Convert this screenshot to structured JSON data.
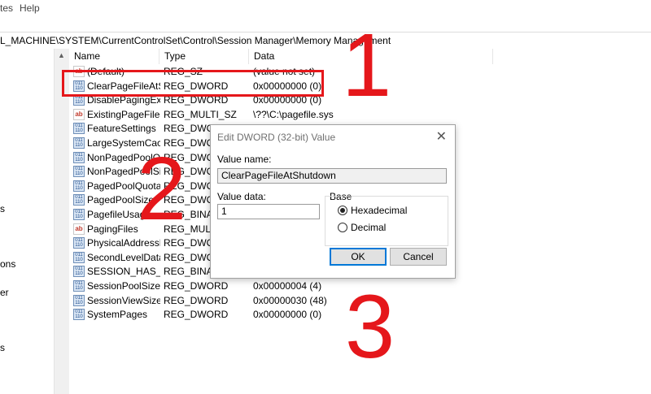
{
  "menubar": {
    "items": [
      "tes",
      "Help"
    ]
  },
  "address": {
    "path": "L_MACHINE\\SYSTEM\\CurrentControlSet\\Control\\Session Manager\\Memory Management"
  },
  "tree": {
    "labels": [
      "s",
      "ons",
      "er",
      "s"
    ]
  },
  "columns": {
    "name": "Name",
    "type": "Type",
    "data": "Data"
  },
  "rows": [
    {
      "icon": "string-value-icon",
      "name": "(Default)",
      "type": "REG_SZ",
      "data": "(value not set)"
    },
    {
      "icon": "binary-value-icon",
      "name": "ClearPageFileAtS...",
      "type": "REG_DWORD",
      "data": "0x00000000 (0)"
    },
    {
      "icon": "binary-value-icon",
      "name": "DisablePagingEx...",
      "type": "REG_DWORD",
      "data": "0x00000000 (0)"
    },
    {
      "icon": "string-value-icon",
      "name": "ExistingPageFiles",
      "type": "REG_MULTI_SZ",
      "data": "\\??\\C:\\pagefile.sys"
    },
    {
      "icon": "binary-value-icon",
      "name": "FeatureSettings",
      "type": "REG_DWORD",
      "data": ""
    },
    {
      "icon": "binary-value-icon",
      "name": "LargeSystemCache",
      "type": "REG_DWORD",
      "data": ""
    },
    {
      "icon": "binary-value-icon",
      "name": "NonPagedPoolQ...",
      "type": "REG_DWORD",
      "data": ""
    },
    {
      "icon": "binary-value-icon",
      "name": "NonPagedPoolSi...",
      "type": "REG_DWORD",
      "data": ""
    },
    {
      "icon": "binary-value-icon",
      "name": "PagedPoolQuota",
      "type": "REG_DWORD",
      "data": ""
    },
    {
      "icon": "binary-value-icon",
      "name": "PagedPoolSize",
      "type": "REG_DWORD",
      "data": ""
    },
    {
      "icon": "binary-value-icon",
      "name": "PagefileUsage",
      "type": "REG_BINARY",
      "data": ""
    },
    {
      "icon": "string-value-icon",
      "name": "PagingFiles",
      "type": "REG_MULTI_SZ",
      "data": ""
    },
    {
      "icon": "binary-value-icon",
      "name": "PhysicalAddressE...",
      "type": "REG_DWORD",
      "data": ""
    },
    {
      "icon": "binary-value-icon",
      "name": "SecondLevelData...",
      "type": "REG_DWORD",
      "data": ""
    },
    {
      "icon": "binary-value-icon",
      "name": "SESSION_HAS_V...",
      "type": "REG_BINARY",
      "data": ""
    },
    {
      "icon": "binary-value-icon",
      "name": "SessionPoolSize",
      "type": "REG_DWORD",
      "data": "0x00000004 (4)"
    },
    {
      "icon": "binary-value-icon",
      "name": "SessionViewSize",
      "type": "REG_DWORD",
      "data": "0x00000030 (48)"
    },
    {
      "icon": "binary-value-icon",
      "name": "SystemPages",
      "type": "REG_DWORD",
      "data": "0x00000000 (0)"
    }
  ],
  "dialog": {
    "title": "Edit DWORD (32-bit) Value",
    "close": "✕",
    "value_name_label": "Value name:",
    "value_name": "ClearPageFileAtShutdown",
    "value_data_label": "Value data:",
    "value_data": "1",
    "base_label": "Base",
    "hex_label": "Hexadecimal",
    "dec_label": "Decimal",
    "ok_label": "OK",
    "cancel_label": "Cancel"
  },
  "annotations": {
    "step1": "1",
    "step2": "2",
    "step3": "3",
    "color": "#e5171b"
  }
}
